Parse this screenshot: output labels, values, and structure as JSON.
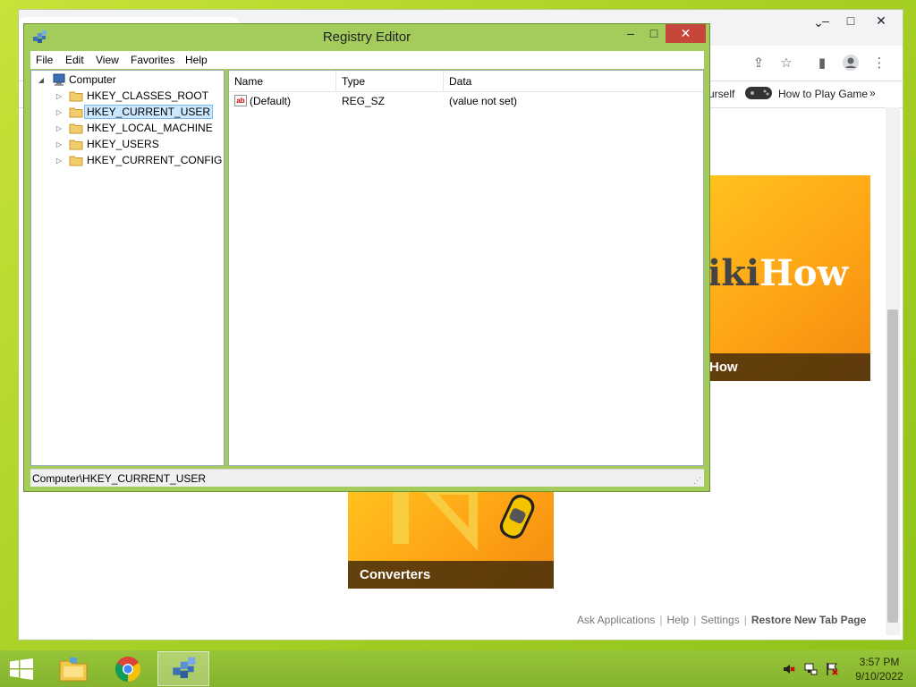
{
  "registry": {
    "title": "Registry Editor",
    "menu": [
      "File",
      "Edit",
      "View",
      "Favorites",
      "Help"
    ],
    "tree": {
      "root": "Computer",
      "keys": [
        "HKEY_CLASSES_ROOT",
        "HKEY_CURRENT_USER",
        "HKEY_LOCAL_MACHINE",
        "HKEY_USERS",
        "HKEY_CURRENT_CONFIG"
      ],
      "selected": "HKEY_CURRENT_USER"
    },
    "columns": [
      "Name",
      "Type",
      "Data"
    ],
    "values": [
      {
        "name": "(Default)",
        "type": "REG_SZ",
        "data": "(value not set)",
        "icon": "ab"
      }
    ],
    "status": "Computer\\HKEY_CURRENT_USER"
  },
  "browser": {
    "bookmarks": [
      "urself",
      "How to Play Game"
    ],
    "bookmarks_more": "»",
    "tiles": [
      {
        "caption": "How",
        "big_dark": "iki",
        "big_light": "How"
      },
      {
        "caption": "Converters"
      }
    ],
    "footer": {
      "links": [
        "Ask Applications",
        "Help",
        "Settings"
      ],
      "separator": "|",
      "restore": "Restore New Tab Page"
    }
  },
  "taskbar": {
    "clock_time": "3:57 PM",
    "clock_date": "9/10/2022"
  },
  "colors": {
    "desktop": "#a9d126",
    "window_frame": "#a4cc5c",
    "close_button": "#c7463b",
    "taskbar": "#8fbd33",
    "tile_orange": "#ffa315",
    "selection": "#cce8ff"
  }
}
